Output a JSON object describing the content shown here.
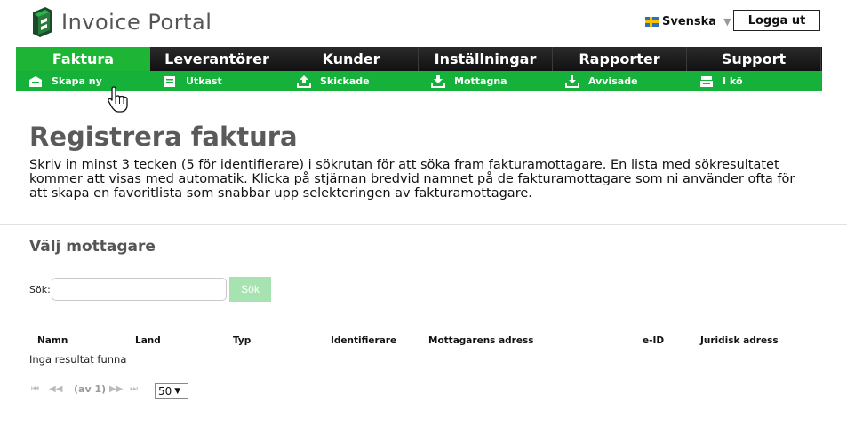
{
  "header": {
    "app_title": "Invoice Portal",
    "language": "Svenska",
    "logout_label": "Logga ut"
  },
  "nav": {
    "tabs": [
      {
        "label": "Faktura",
        "active": true
      },
      {
        "label": "Leverantörer",
        "active": false
      },
      {
        "label": "Kunder",
        "active": false
      },
      {
        "label": "Inställningar",
        "active": false
      },
      {
        "label": "Rapporter",
        "active": false
      },
      {
        "label": "Support",
        "active": false
      }
    ],
    "subitems": [
      {
        "label": "Skapa ny",
        "icon": "create-invoice-icon"
      },
      {
        "label": "Utkast",
        "icon": "draft-icon"
      },
      {
        "label": "Skickade",
        "icon": "sent-icon"
      },
      {
        "label": "Mottagna",
        "icon": "received-icon"
      },
      {
        "label": "Avvisade",
        "icon": "rejected-icon"
      },
      {
        "label": "I kö",
        "icon": "queue-icon"
      }
    ]
  },
  "main": {
    "title": "Registrera faktura",
    "intro": "Skriv in minst 3 tecken (5 för identifierare) i sökrutan för att söka fram fakturamottagare. En lista med sökresultatet\nkommer att visas med automatik. Klicka på stjärnan bredvid namnet på de fakturamottagare som ni använder ofta för\natt skapa en favoritlista som snabbar upp selekteringen av fakturamottagare.",
    "section_title": "Välj mottagare",
    "search_label": "Sök:",
    "search_value": "",
    "search_button": "Sök",
    "columns": [
      "Namn",
      "Land",
      "Typ",
      "Identifierare",
      "Mottagarens adress",
      "e-ID",
      "Juridisk adress"
    ],
    "no_results": "Inga resultat funna",
    "pager_count": "(av 1)",
    "page_size": "50"
  },
  "colors": {
    "brand_green": "#1eb436",
    "nav_dark": "#171717"
  }
}
